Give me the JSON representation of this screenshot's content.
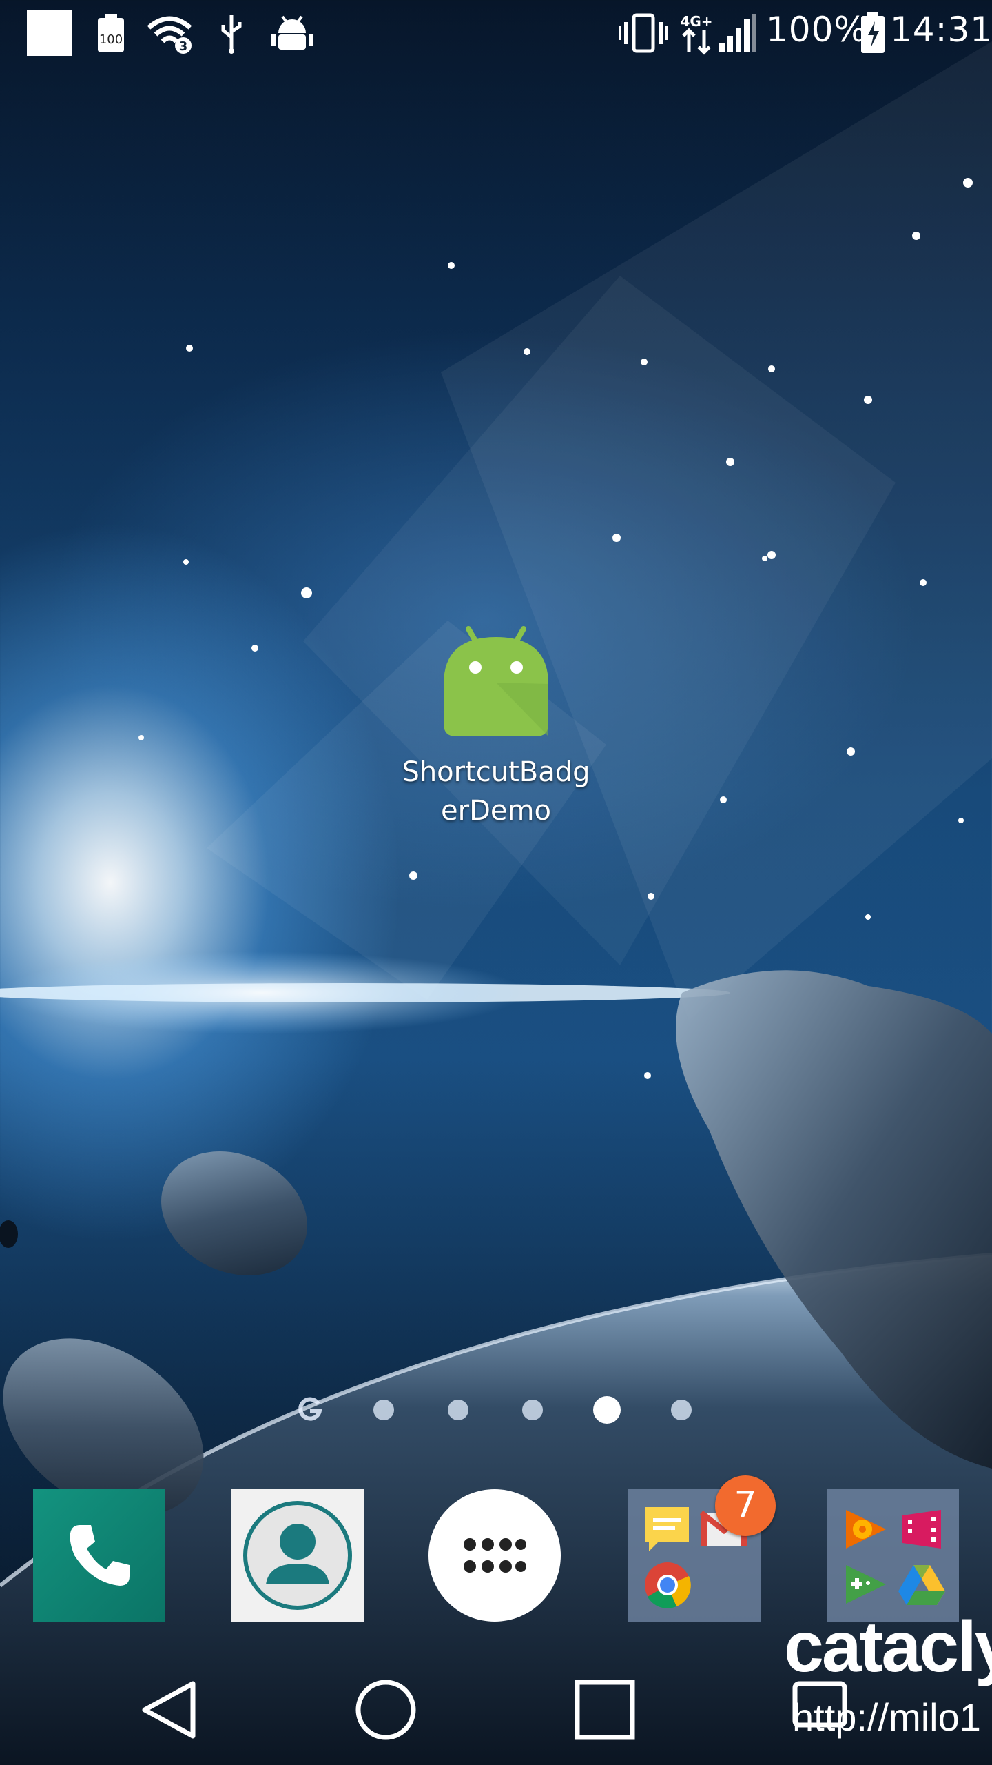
{
  "status_bar": {
    "battery_percent": "100%",
    "time": "14:31",
    "small_battery_label": "100",
    "wifi_badge": "3",
    "network_type": "4G+",
    "icons": [
      "notification-square-icon",
      "battery-saver-icon",
      "wifi-icon",
      "usb-icon",
      "android-debug-icon",
      "vibrate-icon",
      "network-4g-icon",
      "signal-icon",
      "battery-charging-icon"
    ]
  },
  "desktop": {
    "app": {
      "label": "ShortcutBadg\nerDemo",
      "icon": "android-robot-icon",
      "icon_color": "#8bc34a"
    }
  },
  "page_indicator": {
    "pages": 6,
    "active": 5,
    "first_icon": "google-icon"
  },
  "dock": {
    "items": [
      {
        "name": "phone",
        "icon": "phone-icon",
        "color": "#0f8a78"
      },
      {
        "name": "contacts",
        "icon": "contacts-icon",
        "color": "#1b7a7e"
      },
      {
        "name": "app-drawer",
        "icon": "grid-icon"
      },
      {
        "name": "folder-google",
        "badge": "7",
        "apps": [
          "messages-icon",
          "gmail-icon",
          "chrome-icon"
        ]
      },
      {
        "name": "folder-play",
        "apps": [
          "play-music-icon",
          "play-movies-icon",
          "play-games-icon",
          "drive-icon"
        ]
      }
    ],
    "badge_color": "#f26a2e"
  },
  "nav_bar": {
    "buttons": [
      "back-icon",
      "home-icon",
      "recents-icon"
    ]
  },
  "watermark": {
    "line1": "catacly",
    "line2": "http://milo1"
  }
}
